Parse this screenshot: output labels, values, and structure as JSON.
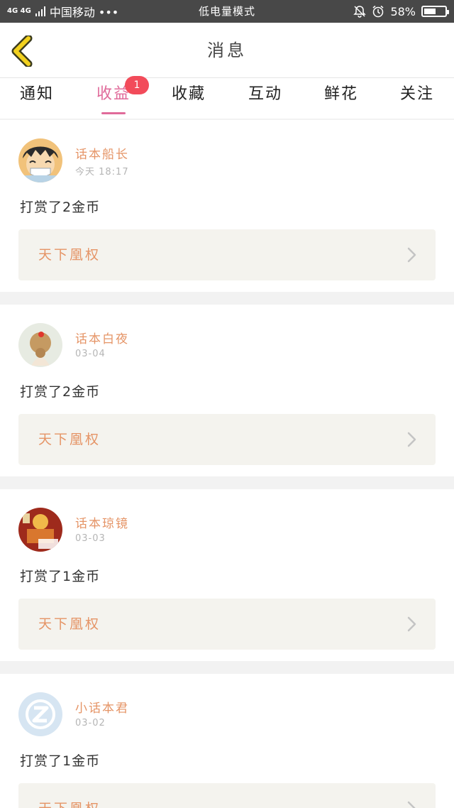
{
  "status_bar": {
    "network": "4G 4G",
    "carrier": "中国移动 •••",
    "mode": "低电量模式",
    "battery_percent": "58%",
    "battery_level": 0.58
  },
  "navbar": {
    "back_icon": "chevron-left-icon",
    "title": "消息"
  },
  "tabs": [
    {
      "label": "通知",
      "active": false
    },
    {
      "label": "收益",
      "active": true,
      "badge": "1"
    },
    {
      "label": "收藏",
      "active": false
    },
    {
      "label": "互动",
      "active": false
    },
    {
      "label": "鲜花",
      "active": false
    },
    {
      "label": "关注",
      "active": false
    }
  ],
  "messages": [
    {
      "user": "话本船长",
      "time": "今天 18:17",
      "text": "打赏了2金币",
      "book": "天下凰权"
    },
    {
      "user": "话本白夜",
      "time": "03-04",
      "text": "打赏了2金币",
      "book": "天下凰权"
    },
    {
      "user": "话本琼镜",
      "time": "03-03",
      "text": "打赏了1金币",
      "book": "天下凰权"
    },
    {
      "user": "小话本君",
      "time": "03-02",
      "text": "打赏了1金币",
      "book": "天下凰权"
    }
  ],
  "colors": {
    "accent_pink": "#e06b9a",
    "name_orange": "#e59466",
    "badge_red": "#f24b5a",
    "back_yellow": "#f2d11e"
  }
}
